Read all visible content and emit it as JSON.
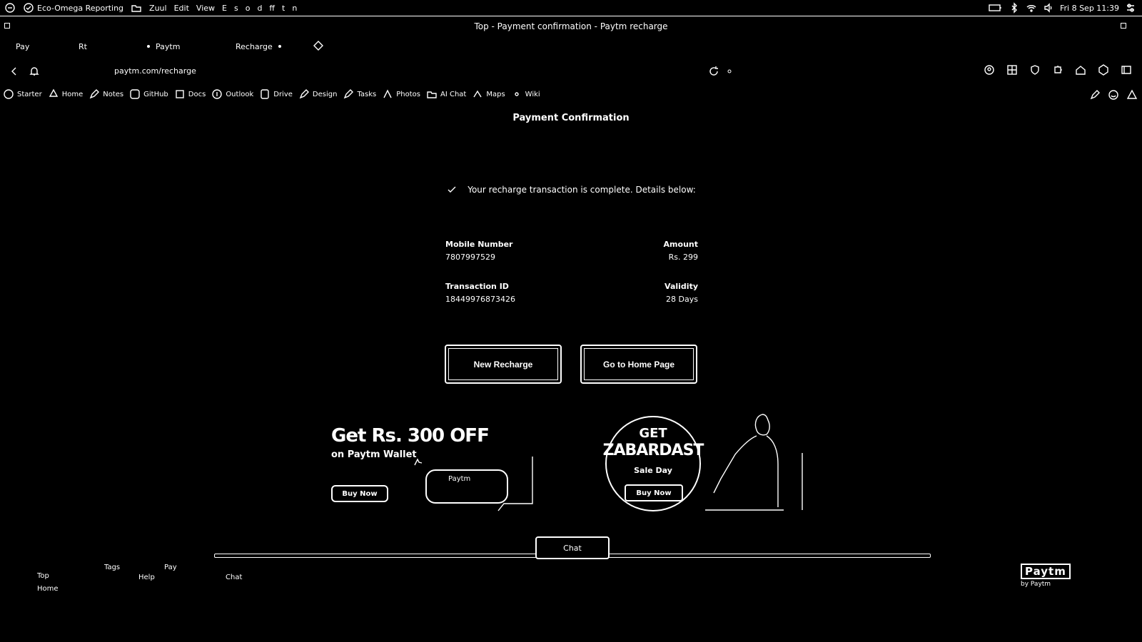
{
  "os_bar": {
    "app_name": "Eco-Omega Reporting",
    "menus": [
      "Zuul",
      "Edit",
      "View",
      "E",
      "s",
      "o",
      "d",
      "ff",
      "t",
      "n"
    ],
    "clock": "Fri 8 Sep 11:39"
  },
  "window": {
    "title": "Top - Payment confirmation - Paytm recharge"
  },
  "tabs": [
    {
      "label": "Pay"
    },
    {
      "label": "Rt"
    },
    {
      "label": "Paytm"
    },
    {
      "label": "Recharge"
    }
  ],
  "address_bar": {
    "url": "paytm.com/recharge"
  },
  "bookmarks": [
    {
      "label": "Starter"
    },
    {
      "label": "Home"
    },
    {
      "label": "Notes"
    },
    {
      "label": "GitHub"
    },
    {
      "label": "Docs"
    },
    {
      "label": "Outlook"
    },
    {
      "label": "Drive"
    },
    {
      "label": "Design"
    },
    {
      "label": "Tasks"
    },
    {
      "label": "Photos"
    },
    {
      "label": "AI Chat"
    },
    {
      "label": "Maps"
    },
    {
      "label": "Wiki"
    }
  ],
  "page": {
    "header": "Payment Confirmation",
    "success_message": "Your recharge transaction is complete. Details below:",
    "details": {
      "left": [
        {
          "label": "Mobile Number",
          "value": "7807997529"
        },
        {
          "label": "Transaction ID",
          "value": "18449976873426"
        }
      ],
      "right": [
        {
          "label": "Amount",
          "value": "Rs. 299"
        },
        {
          "label": "Validity",
          "value": "28 Days"
        }
      ]
    },
    "buttons": {
      "new_recharge": "New Recharge",
      "go_to_home": "Go to Home Page"
    },
    "promo_left": {
      "headline": "Get Rs. 300 OFF",
      "subline": "on Paytm Wallet",
      "cta": "Buy Now",
      "card_label": "Paytm"
    },
    "promo_right": {
      "top": "GET",
      "main": "ZABARDAST",
      "sub": "Sale Day",
      "cta": "Buy Now"
    },
    "sheet_tab": "Chat"
  },
  "footer": {
    "items": [
      "Top",
      "Home",
      "Tags",
      "Help",
      "Pay",
      "Chat"
    ],
    "logo_text": "Paytm",
    "logo_small": "by Paytm"
  }
}
